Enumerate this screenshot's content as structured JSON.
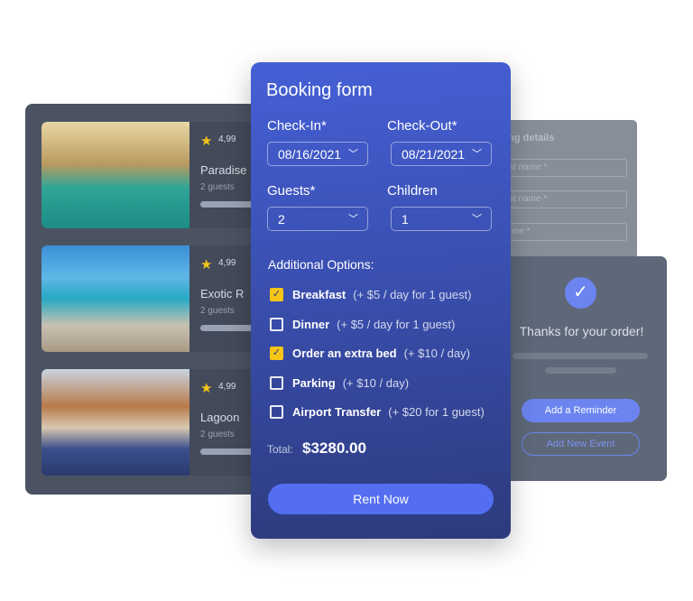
{
  "listings": [
    {
      "rating": "4,99",
      "name": "Paradise",
      "guests": "2 guests",
      "photo": "beach-resort-sunset"
    },
    {
      "rating": "4,99",
      "name": "Exotic R",
      "guests": "2 guests",
      "photo": "overwater-pool-deck"
    },
    {
      "rating": "4,99",
      "name": "Lagoon",
      "guests": "2 guests",
      "photo": "hotel-pool-palms"
    }
  ],
  "details": {
    "title": "ng details",
    "fields": [
      "st name *",
      "st name *",
      "one *"
    ]
  },
  "thanks": {
    "title": "Thanks for your order!",
    "reminder": "Add a Reminder",
    "event": "Add New Event"
  },
  "form": {
    "title": "Booking form",
    "checkin_label": "Check-In*",
    "checkin": "08/16/2021",
    "checkout_label": "Check-Out*",
    "checkout": "08/21/2021",
    "guests_label": "Guests*",
    "guests": "2",
    "children_label": "Children",
    "children": "1",
    "options_label": "Additional Options:",
    "options": [
      {
        "name": "Breakfast",
        "price": "(+ $5 / day for 1 guest)",
        "checked": true
      },
      {
        "name": "Dinner",
        "price": "(+ $5 / day for 1 guest)",
        "checked": false
      },
      {
        "name": "Order an extra bed",
        "price": "(+ $10 / day)",
        "checked": true
      },
      {
        "name": "Parking",
        "price": "(+ $10 / day)",
        "checked": false
      },
      {
        "name": "Airport Transfer",
        "price": "(+ $20 for 1 guest)",
        "checked": false
      }
    ],
    "total_label": "Total:",
    "total": "$3280.00",
    "submit": "Rent Now"
  },
  "colors": {
    "accent": "#536ef0",
    "checkbox": "#f5c518",
    "star": "#f5c518"
  }
}
